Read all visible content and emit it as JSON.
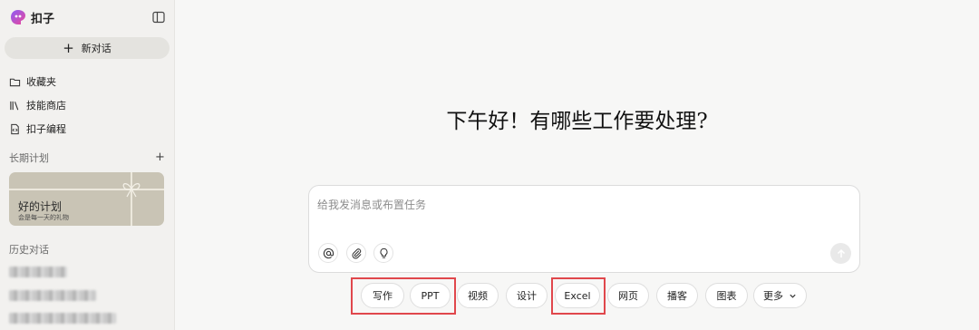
{
  "app": {
    "name": "扣子"
  },
  "sidebar": {
    "new_chat_label": "新对话",
    "nav": [
      {
        "label": "收藏夹",
        "icon": "folder-icon"
      },
      {
        "label": "技能商店",
        "icon": "library-icon"
      },
      {
        "label": "扣子编程",
        "icon": "code-file-icon"
      }
    ],
    "plans_title": "长期计划",
    "plan_card": {
      "title": "好的计划",
      "subtitle": "会是每一天的礼物"
    },
    "history_title": "历史对话"
  },
  "main": {
    "greeting": "下午好！有哪些工作要处理?",
    "input_placeholder": "给我发消息或布置任务",
    "chips": [
      "写作",
      "PPT",
      "视频",
      "设计",
      "Excel",
      "网页",
      "播客",
      "图表",
      "更多"
    ]
  },
  "colors": {
    "highlight": "#e0474c",
    "sidebar_bg": "#f2f1ef",
    "card_bg": "#c9c4b5"
  }
}
